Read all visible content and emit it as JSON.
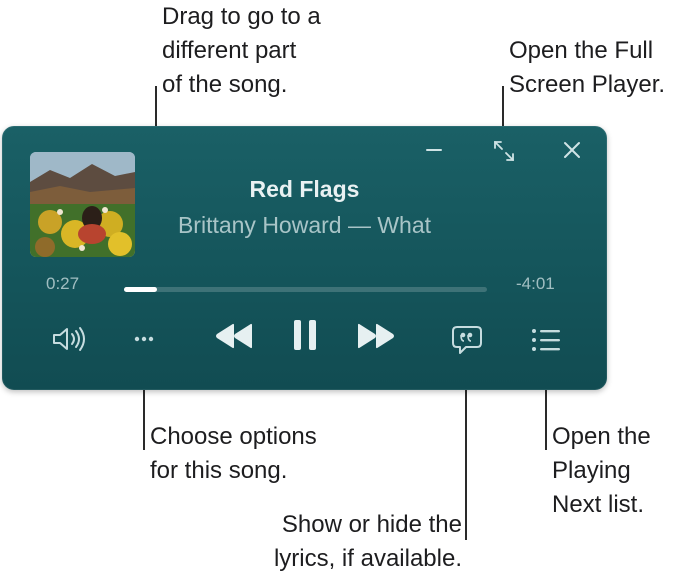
{
  "callouts": {
    "scrub": [
      "Drag to go to a",
      "different part",
      "of the song."
    ],
    "fullscreen": [
      "Open the Full",
      "Screen Player."
    ],
    "options": [
      "Choose options",
      "for this song."
    ],
    "lyrics": [
      "Show or hide the",
      "lyrics, if available."
    ],
    "playing_next": [
      "Open the",
      "Playing",
      "Next list."
    ]
  },
  "player": {
    "song_title": "Red Flags",
    "artist_album": "Brittany Howard — What",
    "elapsed": "0:27",
    "remaining": "-4:01",
    "progress_fraction": 0.09,
    "state": "playing",
    "icons": {
      "minimize": "minimize-icon",
      "fullscreen": "expand-arrows-icon",
      "close": "close-icon",
      "volume": "speaker-volume-icon",
      "options": "more-ellipsis-icon",
      "previous": "rewind-icon",
      "pause": "pause-icon",
      "next": "fast-forward-icon",
      "lyrics": "lyrics-quote-bubble-icon",
      "playing_next": "list-icon"
    },
    "colors": {
      "background": "#15565c",
      "foreground": "#dcebed",
      "progress": "#ffffff"
    }
  }
}
